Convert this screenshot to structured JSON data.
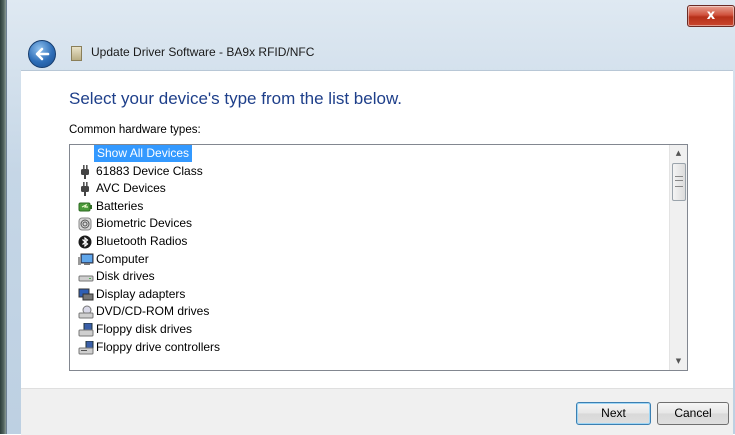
{
  "window": {
    "title": "Update Driver Software - BA9x RFID/NFC",
    "close_label": "x"
  },
  "page": {
    "heading": "Select your device's type from the list below.",
    "subtitle": "Common hardware types:"
  },
  "hardware_types": [
    {
      "label": "Show All Devices",
      "icon": "none",
      "selected": true
    },
    {
      "label": "61883 Device Class",
      "icon": "plug-icon"
    },
    {
      "label": "AVC Devices",
      "icon": "plug-icon"
    },
    {
      "label": "Batteries",
      "icon": "battery-icon"
    },
    {
      "label": "Biometric Devices",
      "icon": "fingerprint-icon"
    },
    {
      "label": "Bluetooth Radios",
      "icon": "bluetooth-icon"
    },
    {
      "label": "Computer",
      "icon": "computer-icon"
    },
    {
      "label": "Disk drives",
      "icon": "disk-drive-icon"
    },
    {
      "label": "Display adapters",
      "icon": "display-adapter-icon"
    },
    {
      "label": "DVD/CD-ROM drives",
      "icon": "dvd-drive-icon"
    },
    {
      "label": "Floppy disk drives",
      "icon": "floppy-drive-icon"
    },
    {
      "label": "Floppy drive controllers",
      "icon": "floppy-controller-icon"
    }
  ],
  "footer": {
    "next_label": "Next",
    "cancel_label": "Cancel"
  },
  "colors": {
    "heading": "#1e3f8a",
    "selection": "#3399ff"
  }
}
